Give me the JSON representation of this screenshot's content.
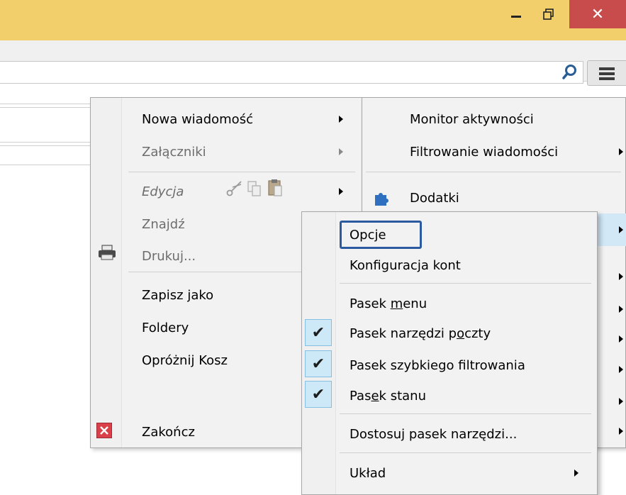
{
  "window": {
    "minimize_glyph": "‒",
    "maximize_glyph": "❐",
    "close_glyph": "✕"
  },
  "left_menu": {
    "items": [
      {
        "label": "Nowa wiadomość",
        "enabled": true,
        "submenu": true
      },
      {
        "label": "Załączniki",
        "enabled": false,
        "submenu": true
      },
      {
        "label": "Edycja",
        "enabled": false,
        "submenu": true,
        "italic": true
      },
      {
        "label": "Znajdź",
        "enabled": false,
        "submenu": false
      },
      {
        "label": "Drukuj...",
        "enabled": false,
        "icon": "printer-icon"
      },
      {
        "label": "Zapisz jako",
        "enabled": true
      },
      {
        "label": "Foldery",
        "enabled": true
      },
      {
        "label": "Opróżnij Kosz",
        "enabled": true
      },
      {
        "label": "Zakończ",
        "enabled": true,
        "icon": "exit-icon"
      }
    ]
  },
  "right_menu": {
    "items": [
      {
        "label": "Monitor aktywności",
        "submenu": false
      },
      {
        "label": "Filtrowanie wiadomości",
        "submenu": true
      },
      {
        "label": "Dodatki",
        "icon": "puzzle-icon"
      }
    ]
  },
  "sub_menu": {
    "items": [
      {
        "label": "Opcje",
        "highlighted": true
      },
      {
        "label": "Konfiguracja kont"
      },
      {
        "label": "Pasek menu",
        "access_key": "m",
        "checked": false,
        "submenu": false
      },
      {
        "label": "Pasek narzędzi poczty",
        "access_key": "o",
        "checked": true
      },
      {
        "label": "Pasek szybkiego filtrowania",
        "checked": true
      },
      {
        "label": "Pasek stanu",
        "access_key": "e",
        "checked": true
      },
      {
        "label": "Dostosuj pasek narzędzi...",
        "checked": false
      },
      {
        "label": "Układ",
        "submenu": true
      }
    ],
    "labels": {
      "opcje": "Opcje",
      "konfig": "Konfiguracja kont",
      "pasek_menu_pre": "Pasek ",
      "pasek_menu_key": "m",
      "pasek_menu_post": "enu",
      "pasek_poczty_pre": "Pasek narzędzi p",
      "pasek_poczty_key": "o",
      "pasek_poczty_post": "czty",
      "pasek_filtr": "Pasek szybkiego filtrowania",
      "pasek_stanu_pre": "Pas",
      "pasek_stanu_key": "e",
      "pasek_stanu_post": "k stanu",
      "dostosuj": "Dostosuj pasek narzędzi...",
      "uklad": "Układ"
    }
  },
  "colors": {
    "titlebar": "#f3cf6b",
    "close_button": "#c94c4c",
    "highlight_box": "#2c5aa0",
    "check_bg": "#cde8f7"
  }
}
